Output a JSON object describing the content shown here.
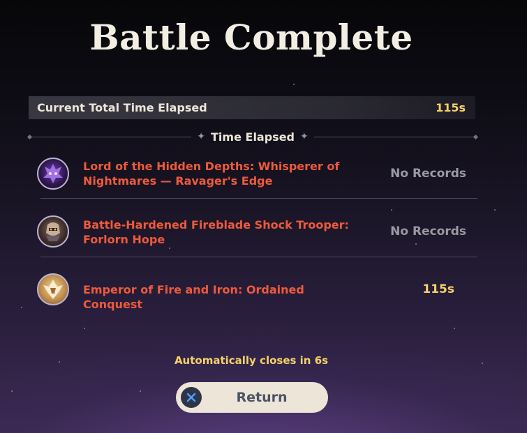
{
  "title": "Battle Complete",
  "total": {
    "label": "Current Total Time Elapsed",
    "value": "115s"
  },
  "section_label": "Time Elapsed",
  "entries": [
    {
      "name": "Lord of the Hidden Depths: Whisperer of Nightmares — Ravager's Edge",
      "value": "No Records",
      "icon": "violet-dragon-boss-icon"
    },
    {
      "name": "Battle-Hardened Fireblade Shock Trooper: Forlorn Hope",
      "value": "No Records",
      "icon": "armored-trooper-boss-icon"
    },
    {
      "name": "Emperor of Fire and Iron: Ordained Conquest",
      "value": "115s",
      "icon": "golden-emperor-boss-icon"
    }
  ],
  "countdown": "Automatically closes in 6s",
  "return_button": {
    "label": "Return",
    "icon": "close-x-icon"
  },
  "colors": {
    "boss_name": "#ee5a3c",
    "highlight_gold": "#f6d26b",
    "no_records_gray": "#9b9aa3",
    "button_bg": "#ece5d8"
  }
}
